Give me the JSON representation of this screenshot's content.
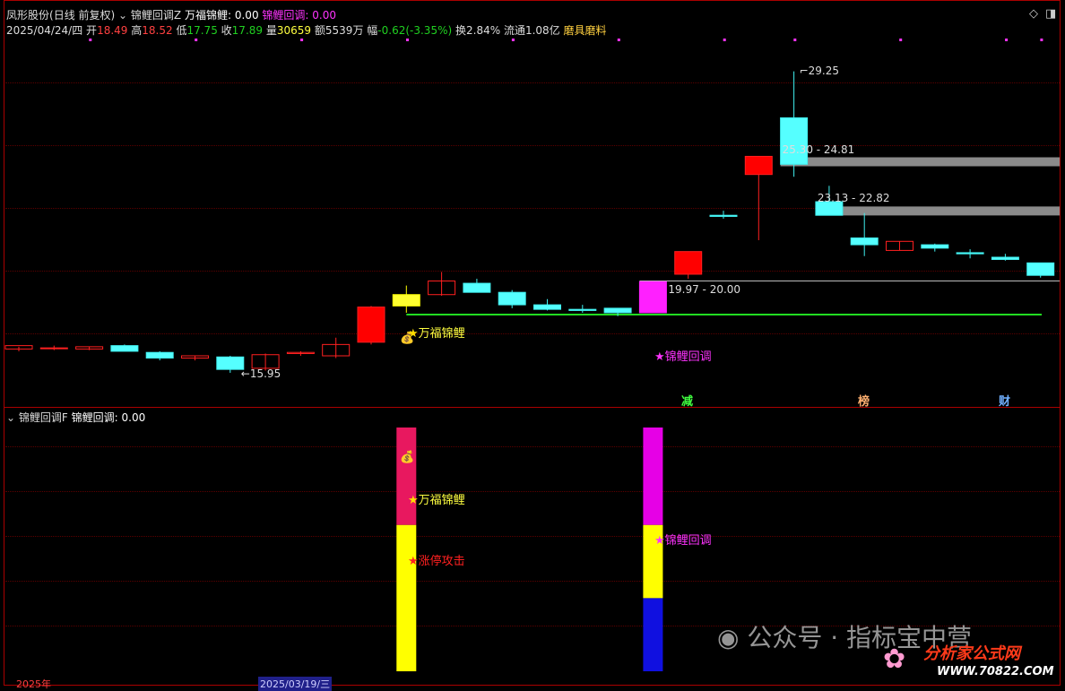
{
  "main_header": {
    "stock": "凤形股份",
    "period": "(日线 前复权)",
    "indicator": "锦鲤回调Z",
    "line1_label": "万福锦鲤:",
    "line1_value": "0.00",
    "line2_label": "锦鲤回调:",
    "line2_value": "0.00"
  },
  "quote": {
    "date": "2025/04/24/四",
    "open_label": "开",
    "open": "18.49",
    "high_label": "高",
    "high": "18.52",
    "low_label": "低",
    "low": "17.75",
    "close_label": "收",
    "close": "17.89",
    "vol_label": "量",
    "vol": "30659",
    "amount_label": "额",
    "amount": "5539万",
    "chg_label": "幅",
    "chg": "-0.62(-3.35%)",
    "turnover": "换2.84%",
    "float_cap": "流通1.08亿",
    "concept": "磨具磨料"
  },
  "chart_data": {
    "type": "candlestick",
    "price_range": [
      15.0,
      30.5
    ],
    "candles": [
      {
        "o": 17.0,
        "h": 17.1,
        "l": 16.9,
        "c": 17.15
      },
      {
        "o": 17.05,
        "h": 17.15,
        "l": 16.95,
        "c": 17.05
      },
      {
        "o": 17.0,
        "h": 17.1,
        "l": 16.95,
        "c": 17.1
      },
      {
        "o": 17.15,
        "h": 17.2,
        "l": 16.9,
        "c": 16.9
      },
      {
        "o": 16.85,
        "h": 16.9,
        "l": 16.5,
        "c": 16.6
      },
      {
        "o": 16.6,
        "h": 16.7,
        "l": 16.5,
        "c": 16.7
      },
      {
        "o": 16.65,
        "h": 16.7,
        "l": 15.95,
        "c": 16.1
      },
      {
        "o": 16.15,
        "h": 16.8,
        "l": 16.05,
        "c": 16.75
      },
      {
        "o": 16.8,
        "h": 16.9,
        "l": 16.7,
        "c": 16.85
      },
      {
        "o": 16.7,
        "h": 17.5,
        "l": 16.6,
        "c": 17.2
      },
      {
        "o": 17.3,
        "h": 18.9,
        "l": 17.2,
        "c": 18.85
      },
      {
        "o": 19.4,
        "h": 19.8,
        "l": 18.6,
        "c": 18.9
      },
      {
        "o": 19.4,
        "h": 20.4,
        "l": 19.35,
        "c": 20.0
      },
      {
        "o": 19.9,
        "h": 20.1,
        "l": 19.5,
        "c": 19.5
      },
      {
        "o": 19.5,
        "h": 19.6,
        "l": 18.8,
        "c": 18.95
      },
      {
        "o": 18.95,
        "h": 19.2,
        "l": 18.7,
        "c": 18.75
      },
      {
        "o": 18.75,
        "h": 18.95,
        "l": 18.6,
        "c": 18.7
      },
      {
        "o": 18.8,
        "h": 18.8,
        "l": 18.45,
        "c": 18.6
      },
      {
        "o": 18.6,
        "h": 19.97,
        "l": 18.6,
        "c": 19.97
      },
      {
        "o": 20.3,
        "h": 21.3,
        "l": 20.1,
        "c": 21.3
      },
      {
        "o": 22.9,
        "h": 23.1,
        "l": 22.75,
        "c": 22.85
      },
      {
        "o": 24.7,
        "h": 25.5,
        "l": 21.8,
        "c": 25.5
      },
      {
        "o": 27.2,
        "h": 29.25,
        "l": 24.6,
        "c": 25.15
      },
      {
        "o": 23.5,
        "h": 24.2,
        "l": 22.9,
        "c": 22.9
      },
      {
        "o": 21.9,
        "h": 23.0,
        "l": 21.1,
        "c": 21.6
      },
      {
        "o": 21.35,
        "h": 21.75,
        "l": 21.35,
        "c": 21.75
      },
      {
        "o": 21.6,
        "h": 21.65,
        "l": 21.3,
        "c": 21.45
      },
      {
        "o": 21.25,
        "h": 21.4,
        "l": 21.0,
        "c": 21.2
      },
      {
        "o": 21.05,
        "h": 21.2,
        "l": 20.9,
        "c": 20.95
      },
      {
        "o": 20.8,
        "h": 20.8,
        "l": 20.15,
        "c": 20.25
      }
    ],
    "support_line": 18.52,
    "zones": [
      {
        "label": "25.30 - 24.81",
        "top": 25.3,
        "bottom": 24.81,
        "from": 22
      },
      {
        "label": "23.13 - 22.82",
        "top": 23.13,
        "bottom": 22.82,
        "from": 23
      },
      {
        "label": "19.97 - 20.00",
        "top": 20.0,
        "bottom": 19.97,
        "from": 18
      }
    ],
    "high_label": "29.25",
    "low_label": "15.95",
    "dot_markers": [
      1,
      4,
      7,
      10,
      13,
      16,
      19,
      21,
      24,
      27,
      28
    ]
  },
  "signals": {
    "wanfu": "万福锦鲤",
    "huitiao": "锦鲤回调",
    "zhangting": "涨停攻击",
    "jian": "减",
    "bang": "榜",
    "cai": "财"
  },
  "sub_header": {
    "indicator": "锦鲤回调F",
    "label": "锦鲤回调:",
    "value": "0.00"
  },
  "sub_chart": {
    "bars": [
      {
        "index": 11,
        "segments": [
          {
            "color": "#e8185f",
            "pct": 40
          },
          {
            "color": "#ffff00",
            "pct": 60
          }
        ]
      },
      {
        "index": 18,
        "segments": [
          {
            "color": "#e600e6",
            "pct": 40
          },
          {
            "color": "#ffff00",
            "pct": 30
          },
          {
            "color": "#1010e0",
            "pct": 30
          }
        ]
      }
    ]
  },
  "watermark": "公众号 · 指标宝中营",
  "logo": {
    "name": "分析家公式网",
    "url": "WWW.70822.COM"
  },
  "bottom": {
    "date1": "2025年",
    "date2": "2025/03/19/三"
  }
}
